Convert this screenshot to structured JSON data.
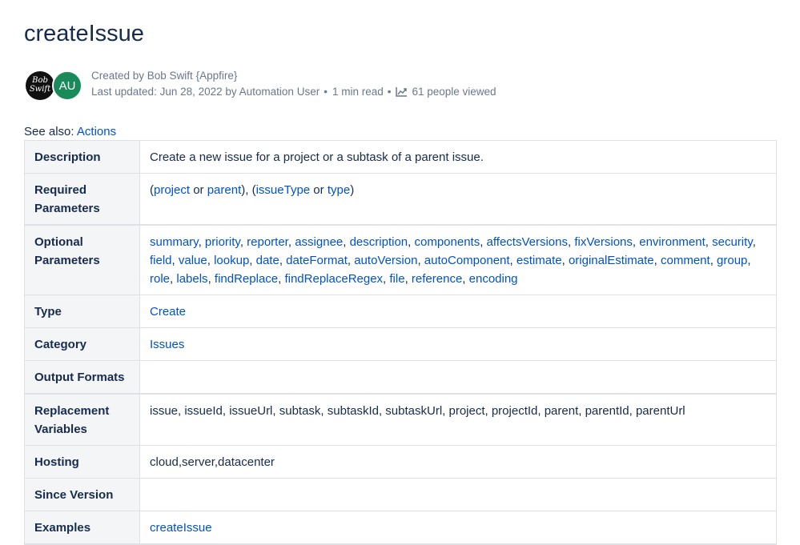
{
  "page": {
    "title": "createIssue"
  },
  "byline": {
    "avatar_bob_line1": "Bob",
    "avatar_bob_line2": "Swift",
    "avatar_au_initials": "AU",
    "created_by": "Created by Bob Swift {Appfire}",
    "last_updated": "Last updated: Jun 28, 2022 by Automation User",
    "separator": "•",
    "read_time": "1 min read",
    "views": "61 people viewed",
    "icon": "chart-trend-icon"
  },
  "see_also": {
    "label": "See also: ",
    "link": "Actions"
  },
  "table": {
    "description": {
      "header": "Description",
      "value": "Create a new issue for a project or a subtask of a parent issue."
    },
    "required": {
      "header": "Required Parameters",
      "open1": "(",
      "link1": "project",
      "or1": " or ",
      "link2": "parent",
      "mid": "), (",
      "link3": "issueType",
      "or2": " or ",
      "link4": "type",
      "close": ")"
    },
    "optional": {
      "header": "Optional Parameters",
      "links": [
        "summary",
        "priority",
        "reporter",
        "assignee",
        "description",
        "components",
        "affectsVersions",
        "fixVersions",
        "environment",
        "security",
        "field",
        "value",
        "lookup",
        "date",
        "dateFormat",
        "autoVersion",
        "autoComponent",
        "estimate",
        "originalEstimate",
        "comment",
        "group",
        "role",
        "labels",
        "findReplace",
        "findReplaceRegex",
        "file",
        "reference",
        "encoding"
      ]
    },
    "type": {
      "header": "Type",
      "link": "Create"
    },
    "category": {
      "header": "Category",
      "link": "Issues"
    },
    "output_formats": {
      "header": "Output Formats",
      "value": ""
    },
    "replacement": {
      "header": "Replacement Variables",
      "value": "issue, issueId, issueUrl, subtask, subtaskId, subtaskUrl, project, projectId, parent, parentId, parentUrl"
    },
    "hosting": {
      "header": "Hosting",
      "value": "cloud,server,datacenter"
    },
    "since_version": {
      "header": "Since Version",
      "value": ""
    },
    "examples": {
      "header": "Examples",
      "link": "createIssue"
    }
  },
  "colors": {
    "text": "#172b4d",
    "muted": "#6b778c",
    "link": "#0052cc",
    "header_bg": "#f4f5f7",
    "border": "#dfe1e6",
    "avatar_au": "#1b8a5a"
  }
}
